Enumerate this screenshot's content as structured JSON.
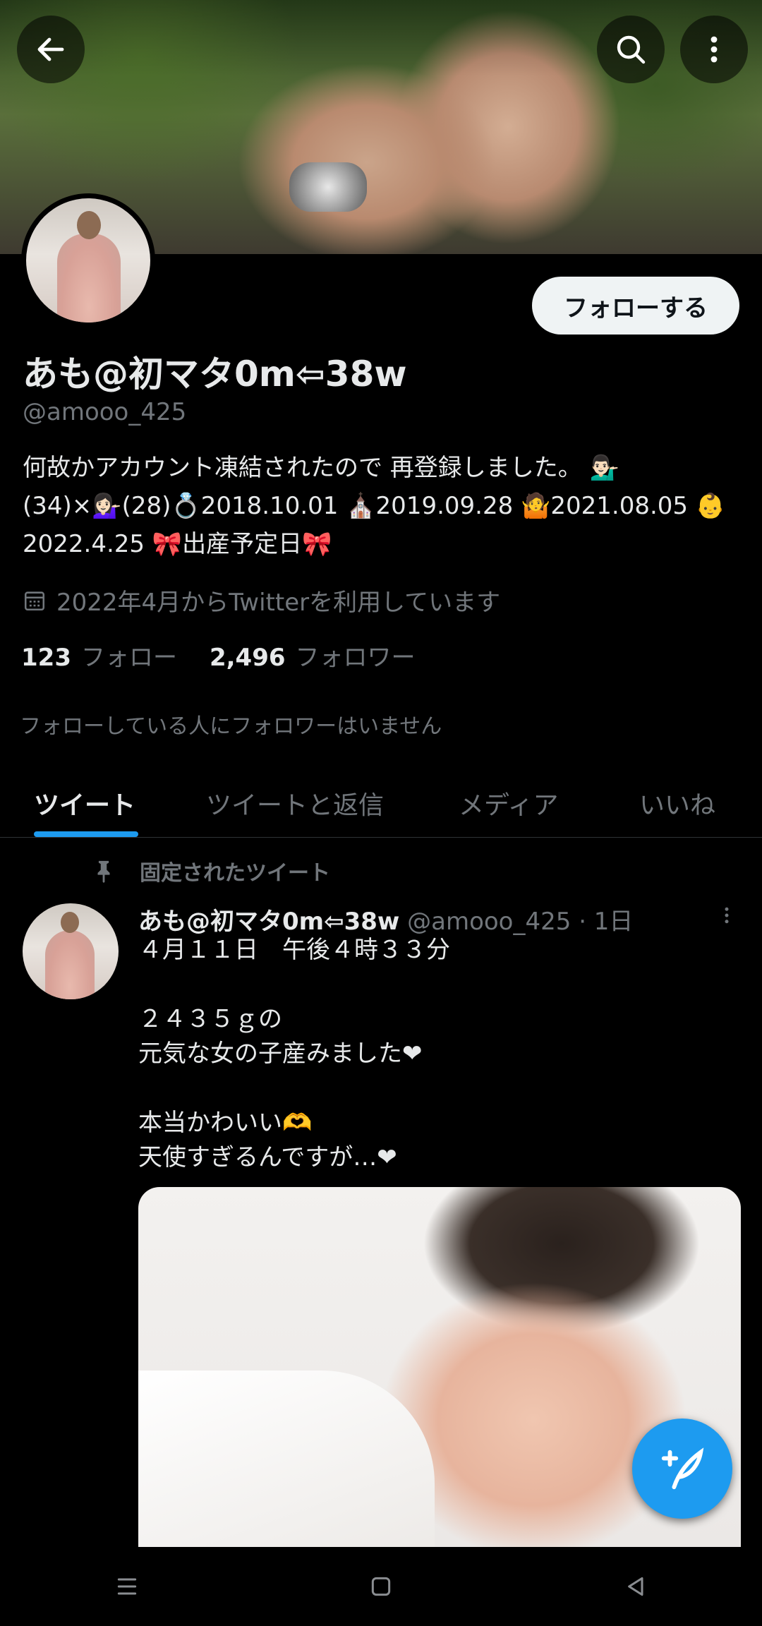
{
  "header": {
    "back_icon": "back-arrow-icon",
    "search_icon": "search-icon",
    "more_icon": "more-vertical-icon"
  },
  "profile": {
    "display_name": "あも@初マタ0m⇦38w",
    "handle": "@amooo_425",
    "follow_button": "フォローする",
    "bio": "何故かアカウント凍結されたので 再登録しました。 💁🏻‍♂️\n(34)×💁🏻‍♀️(28)💍2018.10.01 ⛪2019.09.28 🤷2021.08.05 👶\n2022.4.25 🎀出産予定日🎀",
    "joined": "2022年4月からTwitterを利用しています",
    "following_count": "123",
    "following_label": "フォロー",
    "followers_count": "2,496",
    "followers_label": "フォロワー",
    "followed_by_note": "フォローしている人にフォロワーはいません"
  },
  "tabs": [
    {
      "label": "ツイート",
      "active": true
    },
    {
      "label": "ツイートと返信",
      "active": false
    },
    {
      "label": "メディア",
      "active": false
    },
    {
      "label": "いいね",
      "active": false
    }
  ],
  "pinned_tweet": {
    "pinned_label": "固定されたツイート",
    "author_name": "あも@初マタ0m⇦38w",
    "author_handle_time": "@amooo_425 · 1日",
    "text": "４月１１日　午後４時３３分\n\n２４３５ｇの\n元気な女の子産みました❤\n\n本当かわいい🫶\n天使すぎるんですが…❤"
  },
  "colors": {
    "accent": "#1d9bf0",
    "background": "#000000",
    "secondary_text": "#71767b",
    "primary_text": "#e7e9ea"
  },
  "fab": {
    "icon": "compose-tweet-icon"
  },
  "system_nav": {
    "icons": [
      "menu-icon",
      "home-square-icon",
      "back-triangle-icon"
    ]
  }
}
